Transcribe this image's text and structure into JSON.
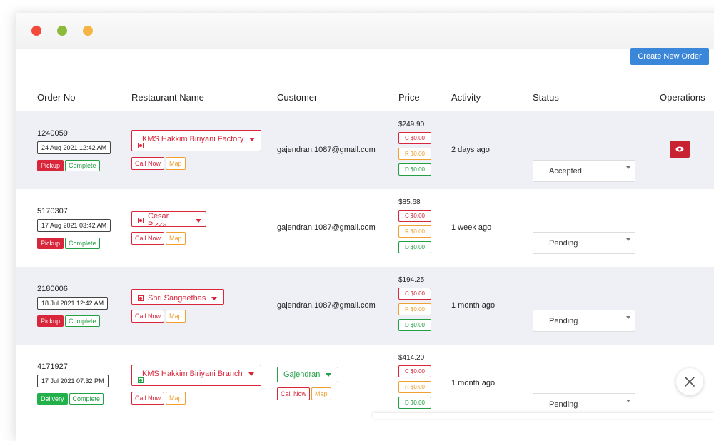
{
  "toolbar": {
    "create_label": "Create New Order"
  },
  "columns": {
    "order_no": "Order No",
    "restaurant": "Restaurant Name",
    "customer": "Customer",
    "price": "Price",
    "activity": "Activity",
    "status": "Status",
    "operations": "Operations"
  },
  "orders": [
    {
      "order_no": "1240059",
      "date": "24 Aug 2021 12:42 AM",
      "type": "Pickup",
      "state": "Complete",
      "restaurant": "KMS Hakkim Biriyani Factory",
      "call_label": "Call Now",
      "map_label": "Map",
      "customer": "gajendran.1087@gmail.com",
      "price": "$249.90",
      "c": "C $0.00",
      "r": "R $0.00",
      "d": "D $0.00",
      "activity": "2 days ago",
      "status": "Accepted"
    },
    {
      "order_no": "5170307",
      "date": "17 Aug 2021 03:42 AM",
      "type": "Pickup",
      "state": "Complete",
      "restaurant": "Cesar Pizza",
      "call_label": "Call Now",
      "map_label": "Map",
      "customer": "gajendran.1087@gmail.com",
      "price": "$85.68",
      "c": "C $0.00",
      "r": "R $0.00",
      "d": "D $0.00",
      "activity": "1 week ago",
      "status": "Pending"
    },
    {
      "order_no": "2180006",
      "date": "18 Jul 2021 12:42 AM",
      "type": "Pickup",
      "state": "Complete",
      "restaurant": "Shri Sangeethas",
      "call_label": "Call Now",
      "map_label": "Map",
      "customer": "gajendran.1087@gmail.com",
      "price": "$194.25",
      "c": "C $0.00",
      "r": "R $0.00",
      "d": "D $0.00",
      "activity": "1 month ago",
      "status": "Pending"
    },
    {
      "order_no": "4171927",
      "date": "17 Jul 2021 07:32 PM",
      "type": "Delivery",
      "state": "Complete",
      "restaurant": "KMS Hakkim Biriyani Branch",
      "call_label": "Call Now",
      "map_label": "Map",
      "customer": "Gajendran",
      "cust_call_label": "Call Now",
      "cust_map_label": "Map",
      "price": "$414.20",
      "c": "C $0.00",
      "r": "R $0.00",
      "d": "D $0.00",
      "activity": "1 month ago",
      "status": "Pending"
    }
  ],
  "colors": {
    "accent": "#3a86d8",
    "danger": "#d9263b",
    "success": "#22a045",
    "warning": "#f0a030"
  },
  "icons": {
    "view": "eye-icon",
    "close": "close-icon",
    "veg": "veg-mark-icon",
    "dropdown": "chevron-down-icon"
  }
}
